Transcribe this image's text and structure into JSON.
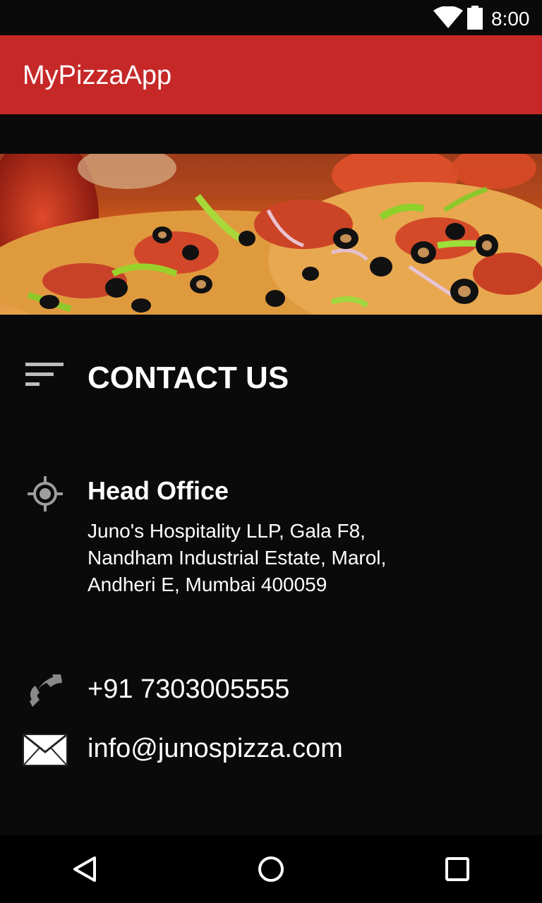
{
  "status_bar": {
    "time": "8:00",
    "icons": [
      "wifi-icon",
      "battery-icon"
    ]
  },
  "app_bar": {
    "title": "MyPizzaApp",
    "color": "#c62828"
  },
  "hero": {
    "image": "pizza-banner-image"
  },
  "contact": {
    "heading": "CONTACT US",
    "icon": "sort-icon"
  },
  "office": {
    "title": "Head Office",
    "address": "Juno's Hospitality LLP, Gala F8,\nNandham Industrial Estate,  Marol,\nAndheri E, Mumbai 400059",
    "icon": "location-icon"
  },
  "phone": {
    "number": "+91 7303005555",
    "icon": "phone-icon"
  },
  "email": {
    "address": "info@junospizza.com",
    "icon": "mail-icon"
  },
  "nav_bar": {
    "buttons": [
      "back-icon",
      "home-icon",
      "recents-icon"
    ]
  }
}
